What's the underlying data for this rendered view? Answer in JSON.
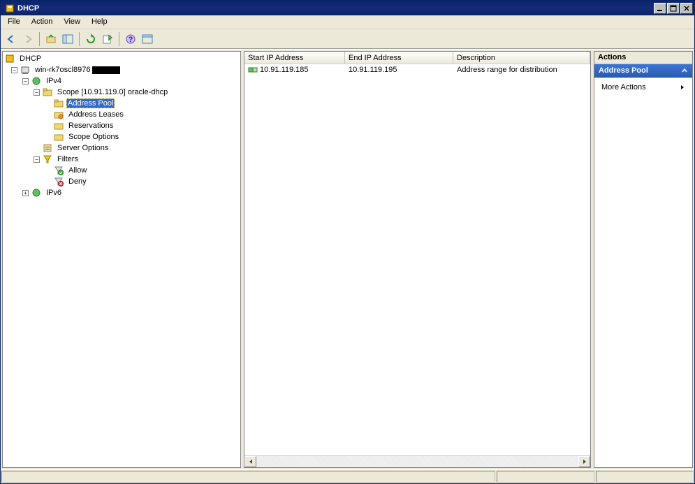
{
  "window": {
    "title": "DHCP"
  },
  "menu": {
    "file": "File",
    "action": "Action",
    "view": "View",
    "help": "Help"
  },
  "tree": {
    "root": "DHCP",
    "server": "win-rk7oscl8976",
    "ipv4": "IPv4",
    "scope": "Scope [10.91.119.0] oracle-dhcp",
    "address_pool": "Address Pool",
    "address_leases": "Address Leases",
    "reservations": "Reservations",
    "scope_options": "Scope Options",
    "server_options": "Server Options",
    "filters": "Filters",
    "allow": "Allow",
    "deny": "Deny",
    "ipv6": "IPv6"
  },
  "list": {
    "columns": {
      "start": "Start IP Address",
      "end": "End IP Address",
      "desc": "Description"
    },
    "row": {
      "start": "10.91.119.185",
      "end": "10.91.119.195",
      "desc": "Address range for distribution"
    }
  },
  "actions": {
    "title": "Actions",
    "section": "Address Pool",
    "more": "More Actions"
  }
}
